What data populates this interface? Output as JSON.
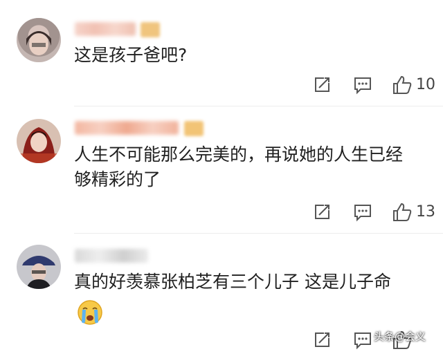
{
  "comments": [
    {
      "text": "这是孩子爸吧?",
      "likes": "10"
    },
    {
      "text": "人生不可能那么完美的，再说她的人生已经\n够精彩的了",
      "likes": "13"
    },
    {
      "text": "真的好羡慕张柏芝有三个儿子 这是儿子命",
      "emoji": "crying-face",
      "likes": ""
    }
  ],
  "watermark": "头条@会义",
  "icons": {
    "share": "share-icon",
    "reply": "reply-icon",
    "like": "thumbs-up-icon"
  },
  "colors": {
    "icon": "#555555",
    "divider": "#ececec",
    "name_blur_1": "#f3c9bd",
    "name_blur_2": "#f0b59e",
    "badge": "#f2c476"
  }
}
